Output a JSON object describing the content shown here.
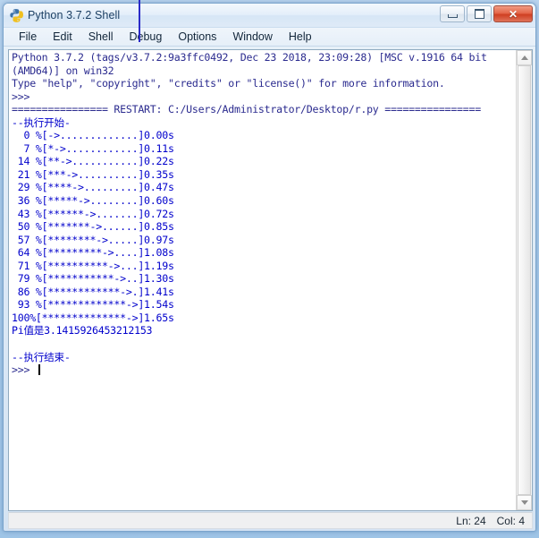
{
  "window": {
    "title": "Python 3.7.2 Shell",
    "icon": "python-logo-icon",
    "controls": {
      "minimize_label": "–",
      "maximize_label": "□",
      "close_label": "✕"
    }
  },
  "menubar": {
    "items": [
      {
        "label": "File"
      },
      {
        "label": "Edit"
      },
      {
        "label": "Shell"
      },
      {
        "label": "Debug"
      },
      {
        "label": "Options"
      },
      {
        "label": "Window"
      },
      {
        "label": "Help"
      }
    ]
  },
  "console": {
    "banner": "Python 3.7.2 (tags/v3.7.2:9a3ffc0492, Dec 23 2018, 23:09:28) [MSC v.1916 64 bit\n(AMD64)] on win32\nType \"help\", \"copyright\", \"credits\" or \"license()\" for more information.\n>>> ",
    "restart_line": "================ RESTART: C:/Users/Administrator/Desktop/r.py ================",
    "output": "--执行开始-\n  0 %[->.............]0.00s\n  7 %[*->............]0.11s\n 14 %[**->...........]0.22s\n 21 %[***->..........]0.35s\n 29 %[****->.........]0.47s\n 36 %[*****->........]0.60s\n 43 %[******->.......]0.72s\n 50 %[*******->......]0.85s\n 57 %[********->.....]0.97s\n 64 %[*********->....]1.08s\n 71 %[**********->...]1.19s\n 79 %[***********->..]1.30s\n 86 %[************->.]1.41s\n 93 %[*************->]1.54s\n100%[**************->]1.65s\nPi值是3.1415926453212153\n\n--执行结束-\n",
    "final_prompt": ">>> "
  },
  "statusbar": {
    "line_label": "Ln: 24",
    "col_label": "Col: 4"
  },
  "colors": {
    "output_text": "#0000cc",
    "banner_text": "#2b2b8f",
    "close_button": "#cf3f22",
    "window_border": "#7ba5cd"
  }
}
